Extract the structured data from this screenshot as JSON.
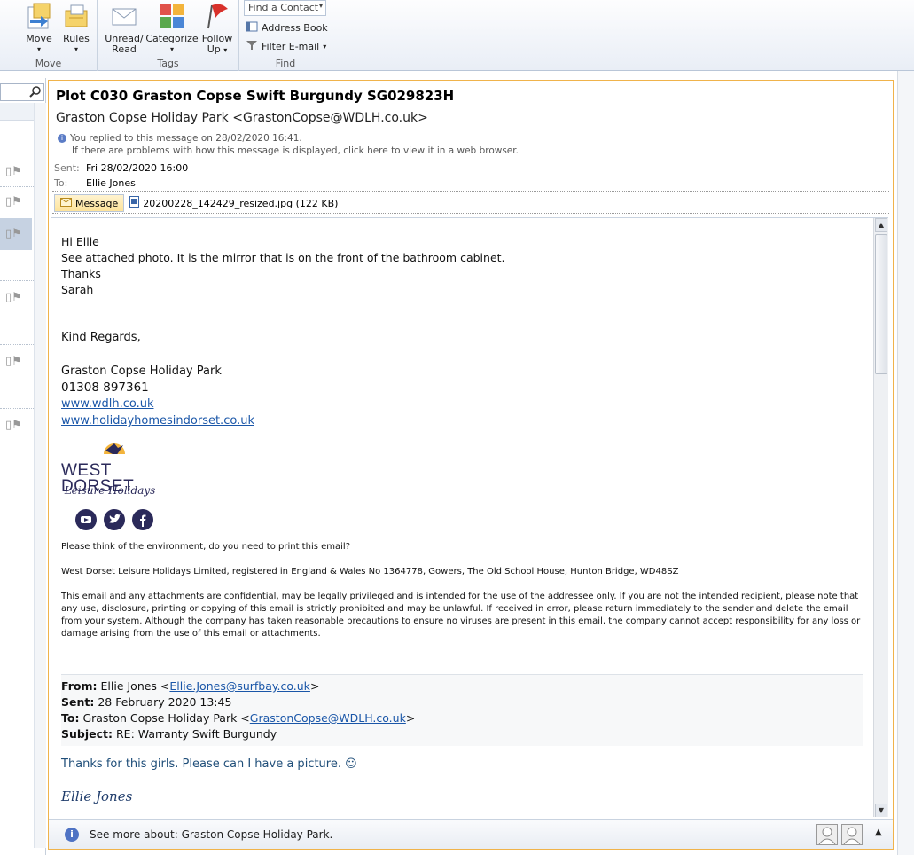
{
  "ribbon": {
    "move_btn": "Move",
    "rules_btn": "Rules",
    "unread_btn_l1": "Unread/",
    "unread_btn_l2": "Read",
    "categorize_btn": "Categorize",
    "follow_btn_l1": "Follow",
    "follow_btn_l2": "Up",
    "group_move": "Move",
    "group_tags": "Tags",
    "group_find": "Find",
    "find_contact": "Find a Contact",
    "address_book": "Address Book",
    "filter_email": "Filter E-mail"
  },
  "message": {
    "subject": "Plot C030 Graston Copse Swift Burgundy SG029823H",
    "from": "Graston Copse Holiday Park <GrastonCopse@WDLH.co.uk>",
    "info1": "You replied to this message on 28/02/2020 16:41.",
    "info2": "If there are problems with how this message is displayed, click here to view it in a web browser.",
    "sent_label": "Sent:",
    "sent_value": "Fri 28/02/2020 16:00",
    "to_label": "To:",
    "to_value": "Ellie Jones",
    "tab_message": "Message",
    "attachment": "20200228_142429_resized.jpg (122 KB)"
  },
  "body": {
    "l1": "Hi Ellie",
    "l2": "See attached photo. It is the mirror that is on the front of the bathroom cabinet.",
    "l3": "Thanks",
    "l4": "Sarah",
    "regards": "Kind Regards,",
    "company": "Graston Copse Holiday Park",
    "phone": "01308 897361",
    "link1": "www.wdlh.co.uk",
    "link2": "www.holidayhomesindorset.co.uk",
    "logo_main": "WEST DORSET",
    "logo_sub": "Leisure Holidays",
    "env": "Please think of the environment, do you need to print this email?",
    "reg": "West Dorset Leisure Holidays Limited, registered in England & Wales No 1364778, Gowers, The Old School House, Hunton Bridge, WD48SZ",
    "disclaimer": "This email and any attachments are confidential, may be legally privileged and is intended for the use of the addressee only. If you are not the intended recipient, please note that any use, disclosure, printing or copying of this email is strictly prohibited and may be unlawful. If received in error, please return immediately to the sender and delete the email from your system. Although the company has taken reasonable precautions to ensure no viruses are present in this email, the company cannot accept responsibility for any loss or damage arising from the use of this email or attachments.",
    "fwd_from_label": "From:",
    "fwd_from_name": "Ellie Jones <",
    "fwd_from_email": "Ellie.Jones@surfbay.co.uk",
    "fwd_from_end": ">",
    "fwd_sent_label": "Sent:",
    "fwd_sent_value": "28 February 2020 13:45",
    "fwd_to_label": "To:",
    "fwd_to_name": "Graston Copse Holiday Park <",
    "fwd_to_email": "GrastonCopse@WDLH.co.uk",
    "fwd_to_end": ">",
    "fwd_subject_label": "Subject:",
    "fwd_subject_value": "RE: Warranty Swift Burgundy",
    "reply": "Thanks for this girls. Please can I have a picture. ☺",
    "signature": "Ellie Jones"
  },
  "people_pane": {
    "text": "See more about: Graston Copse Holiday Park."
  },
  "colors": {
    "accent": "#f0b34b",
    "link": "#1a56a8",
    "logo_navy": "#2b2a5a"
  }
}
